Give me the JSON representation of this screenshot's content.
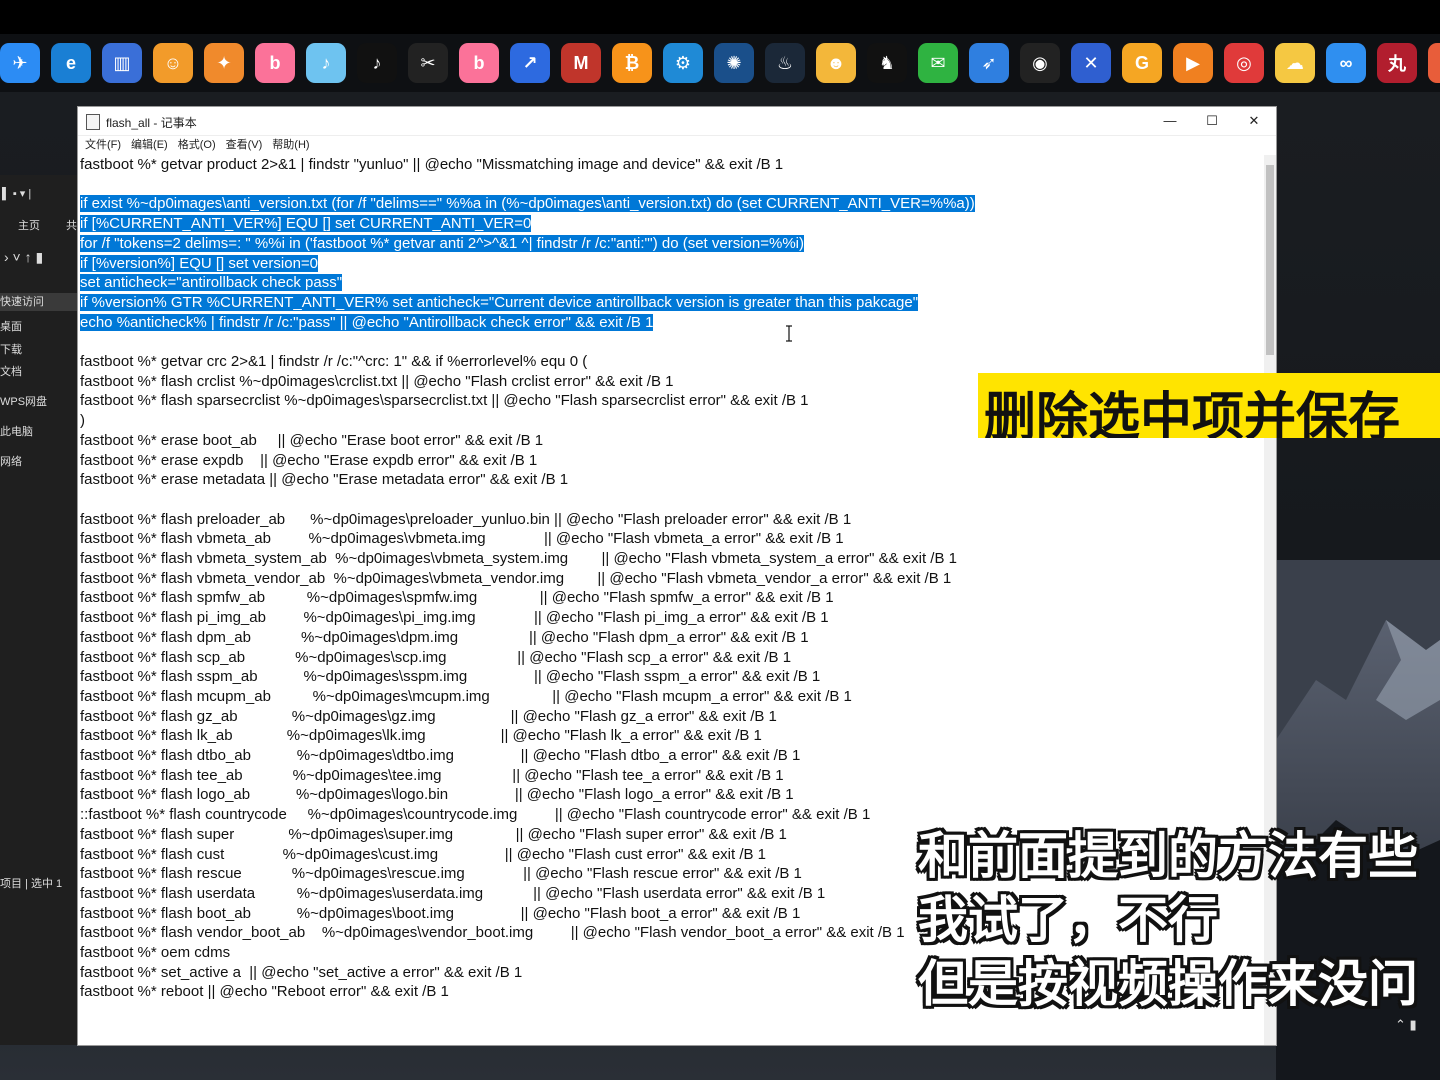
{
  "notepad": {
    "title": "flash_all - 记事本",
    "menu": [
      "文件(F)",
      "编辑(E)",
      "格式(O)",
      "查看(V)",
      "帮助(H)"
    ],
    "win_minimize": "—",
    "win_maximize": "☐",
    "win_close": "✕",
    "lines": [
      {
        "text": "fastboot %* getvar product 2>&1 | findstr \"yunluo\" || @echo \"Missmatching image and device\" && exit /B 1",
        "selected": false
      },
      {
        "text": "",
        "selected": false
      },
      {
        "text": "if exist %~dp0images\\anti_version.txt (for /f \"delims==\" %%a in (%~dp0images\\anti_version.txt) do (set CURRENT_ANTI_VER=%%a))",
        "selected": true
      },
      {
        "text": "if [%CURRENT_ANTI_VER%] EQU [] set CURRENT_ANTI_VER=0",
        "selected": true
      },
      {
        "text": "for /f \"tokens=2 delims=: \" %%i in ('fastboot %* getvar anti 2^>^&1 ^| findstr /r /c:\"anti:\"') do (set version=%%i)",
        "selected": true
      },
      {
        "text": "if [%version%] EQU [] set version=0",
        "selected": true
      },
      {
        "text": "set anticheck=\"antirollback check pass\"",
        "selected": true
      },
      {
        "text": "if %version% GTR %CURRENT_ANTI_VER% set anticheck=\"Current device antirollback version is greater than this pakcage\"",
        "selected": true
      },
      {
        "text": "echo %anticheck% | findstr /r /c:\"pass\" || @echo \"Antirollback check error\" && exit /B 1",
        "selected": true
      },
      {
        "text": "",
        "selected": false
      },
      {
        "text": "fastboot %* getvar crc 2>&1 | findstr /r /c:\"^crc: 1\" && if %errorlevel% equ 0 (",
        "selected": false
      },
      {
        "text": "fastboot %* flash crclist %~dp0images\\crclist.txt || @echo \"Flash crclist error\" && exit /B 1",
        "selected": false
      },
      {
        "text": "fastboot %* flash sparsecrclist %~dp0images\\sparsecrclist.txt || @echo \"Flash sparsecrclist error\" && exit /B 1",
        "selected": false
      },
      {
        "text": ")",
        "selected": false
      },
      {
        "text": "fastboot %* erase boot_ab     || @echo \"Erase boot error\" && exit /B 1",
        "selected": false
      },
      {
        "text": "fastboot %* erase expdb    || @echo \"Erase expdb error\" && exit /B 1",
        "selected": false
      },
      {
        "text": "fastboot %* erase metadata || @echo \"Erase metadata error\" && exit /B 1",
        "selected": false
      },
      {
        "text": "",
        "selected": false
      },
      {
        "text": "fastboot %* flash preloader_ab      %~dp0images\\preloader_yunluo.bin || @echo \"Flash preloader error\" && exit /B 1",
        "selected": false
      },
      {
        "text": "fastboot %* flash vbmeta_ab         %~dp0images\\vbmeta.img              || @echo \"Flash vbmeta_a error\" && exit /B 1",
        "selected": false
      },
      {
        "text": "fastboot %* flash vbmeta_system_ab  %~dp0images\\vbmeta_system.img        || @echo \"Flash vbmeta_system_a error\" && exit /B 1",
        "selected": false
      },
      {
        "text": "fastboot %* flash vbmeta_vendor_ab  %~dp0images\\vbmeta_vendor.img        || @echo \"Flash vbmeta_vendor_a error\" && exit /B 1",
        "selected": false
      },
      {
        "text": "fastboot %* flash spmfw_ab          %~dp0images\\spmfw.img               || @echo \"Flash spmfw_a error\" && exit /B 1",
        "selected": false
      },
      {
        "text": "fastboot %* flash pi_img_ab         %~dp0images\\pi_img.img              || @echo \"Flash pi_img_a error\" && exit /B 1",
        "selected": false
      },
      {
        "text": "fastboot %* flash dpm_ab            %~dp0images\\dpm.img                 || @echo \"Flash dpm_a error\" && exit /B 1",
        "selected": false
      },
      {
        "text": "fastboot %* flash scp_ab            %~dp0images\\scp.img                 || @echo \"Flash scp_a error\" && exit /B 1",
        "selected": false
      },
      {
        "text": "fastboot %* flash sspm_ab           %~dp0images\\sspm.img                || @echo \"Flash sspm_a error\" && exit /B 1",
        "selected": false
      },
      {
        "text": "fastboot %* flash mcupm_ab          %~dp0images\\mcupm.img               || @echo \"Flash mcupm_a error\" && exit /B 1",
        "selected": false
      },
      {
        "text": "fastboot %* flash gz_ab             %~dp0images\\gz.img                  || @echo \"Flash gz_a error\" && exit /B 1",
        "selected": false
      },
      {
        "text": "fastboot %* flash lk_ab             %~dp0images\\lk.img                  || @echo \"Flash lk_a error\" && exit /B 1",
        "selected": false
      },
      {
        "text": "fastboot %* flash dtbo_ab           %~dp0images\\dtbo.img                || @echo \"Flash dtbo_a error\" && exit /B 1",
        "selected": false
      },
      {
        "text": "fastboot %* flash tee_ab            %~dp0images\\tee.img                 || @echo \"Flash tee_a error\" && exit /B 1",
        "selected": false
      },
      {
        "text": "fastboot %* flash logo_ab           %~dp0images\\logo.bin                || @echo \"Flash logo_a error\" && exit /B 1",
        "selected": false
      },
      {
        "text": "::fastboot %* flash countrycode     %~dp0images\\countrycode.img         || @echo \"Flash countrycode error\" && exit /B 1",
        "selected": false
      },
      {
        "text": "fastboot %* flash super             %~dp0images\\super.img               || @echo \"Flash super error\" && exit /B 1",
        "selected": false
      },
      {
        "text": "fastboot %* flash cust              %~dp0images\\cust.img                || @echo \"Flash cust error\" && exit /B 1",
        "selected": false
      },
      {
        "text": "fastboot %* flash rescue            %~dp0images\\rescue.img              || @echo \"Flash rescue error\" && exit /B 1",
        "selected": false
      },
      {
        "text": "fastboot %* flash userdata          %~dp0images\\userdata.img            || @echo \"Flash userdata error\" && exit /B 1",
        "selected": false
      },
      {
        "text": "fastboot %* flash boot_ab           %~dp0images\\boot.img                || @echo \"Flash boot_a error\" && exit /B 1",
        "selected": false
      },
      {
        "text": "fastboot %* flash vendor_boot_ab    %~dp0images\\vendor_boot.img         || @echo \"Flash vendor_boot_a error\" && exit /B 1",
        "selected": false
      },
      {
        "text": "fastboot %* oem cdms",
        "selected": false
      },
      {
        "text": "fastboot %* set_active a  || @echo \"set_active a error\" && exit /B 1",
        "selected": false
      },
      {
        "text": "fastboot %* reboot || @echo \"Reboot error\" && exit /B 1",
        "selected": false
      }
    ]
  },
  "explorer": {
    "tab_home": "主页",
    "tab_share": "共",
    "items": [
      "快速访问",
      "桌面",
      "下载",
      "文档",
      "WPS网盘",
      "此电脑",
      "网络"
    ],
    "status": "项目 | 选中 1"
  },
  "captions": {
    "yellow": "删除选中项并保存",
    "line1": "和前面提到的方法有些",
    "line2": "我试了，不行",
    "line3": "但是按视频操作来没问"
  },
  "dock_icons": [
    {
      "name": "bird-icon",
      "color": "#2c8cf4",
      "glyph": "✈"
    },
    {
      "name": "edge-icon",
      "color": "#1a7fd4",
      "glyph": "e"
    },
    {
      "name": "app-icon",
      "color": "#3a6fd8",
      "glyph": "▥"
    },
    {
      "name": "face-app-icon",
      "color": "#f29b2a",
      "glyph": "☺"
    },
    {
      "name": "fox-app-icon",
      "color": "#f08a2c",
      "glyph": "✦"
    },
    {
      "name": "bilibili-icon",
      "color": "#fb7299",
      "glyph": "b"
    },
    {
      "name": "live-app-icon",
      "color": "#6ec3f0",
      "glyph": "♪"
    },
    {
      "name": "tiktok-icon",
      "color": "#111111",
      "glyph": "♪"
    },
    {
      "name": "capcut-icon",
      "color": "#222222",
      "glyph": "✂"
    },
    {
      "name": "bilibili-alt-icon",
      "color": "#fb7299",
      "glyph": "b"
    },
    {
      "name": "signal-app-icon",
      "color": "#2d6ae0",
      "glyph": "↗"
    },
    {
      "name": "m-app-icon",
      "color": "#c0352b",
      "glyph": "M"
    },
    {
      "name": "bitcoin-icon",
      "color": "#f7931a",
      "glyph": "₿"
    },
    {
      "name": "gear-app-icon",
      "color": "#1f8ad6",
      "glyph": "⚙"
    },
    {
      "name": "cog-app-icon",
      "color": "#1a4f8a",
      "glyph": "✺"
    },
    {
      "name": "steam-icon",
      "color": "#1b2838",
      "glyph": "♨"
    },
    {
      "name": "cat-app-icon",
      "color": "#f3b73a",
      "glyph": "☻"
    },
    {
      "name": "qq-icon",
      "color": "#111111",
      "glyph": "♞"
    },
    {
      "name": "wechat-icon",
      "color": "#2fb341",
      "glyph": "✉"
    },
    {
      "name": "feather-app-icon",
      "color": "#2f7fe0",
      "glyph": "➶"
    },
    {
      "name": "mix-app-icon",
      "color": "#222222",
      "glyph": "◉"
    },
    {
      "name": "tools-app-icon",
      "color": "#2f5fd0",
      "glyph": "✕"
    },
    {
      "name": "g-app-icon",
      "color": "#f5a623",
      "glyph": "G"
    },
    {
      "name": "play-app-icon",
      "color": "#f08020",
      "glyph": "▶"
    },
    {
      "name": "netease-music-icon",
      "color": "#e03a3a",
      "glyph": "◎"
    },
    {
      "name": "cloud-app-icon",
      "color": "#f5c842",
      "glyph": "☁"
    },
    {
      "name": "baidu-cloud-icon",
      "color": "#2f8ff0",
      "glyph": "∞"
    },
    {
      "name": "wan-app-icon",
      "color": "#b21e2e",
      "glyph": "丸"
    },
    {
      "name": "photo-app-icon",
      "color": "#e85d3a",
      "glyph": "▣"
    },
    {
      "name": "monitor-app-icon",
      "color": "#c84a3a",
      "glyph": "▤"
    }
  ]
}
